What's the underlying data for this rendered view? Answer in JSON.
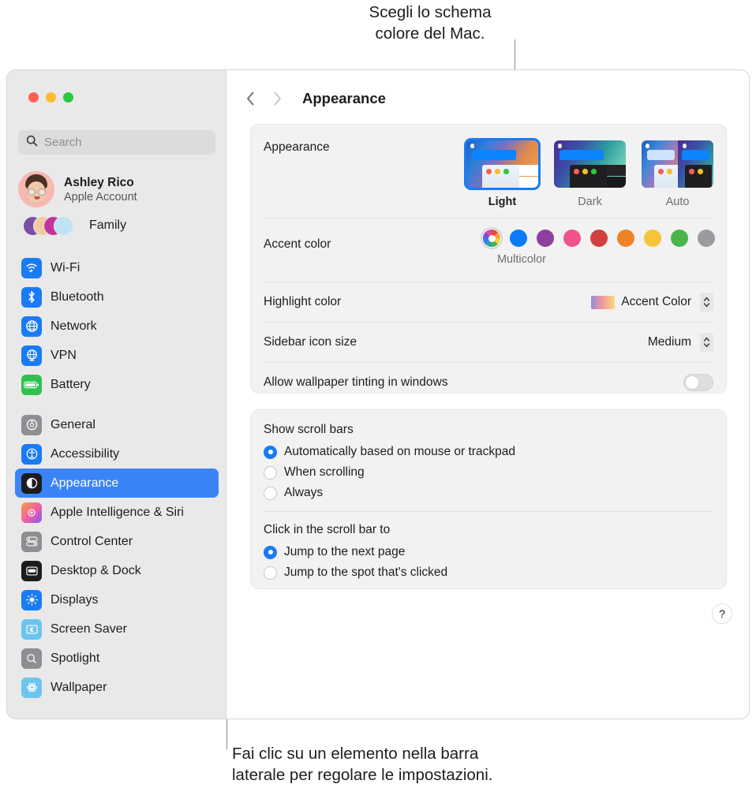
{
  "callouts": {
    "top": "Scegli lo schema\ncolore del Mac.",
    "bottom": "Fai clic su un elemento nella barra\nlaterale per regolare le impostazioni."
  },
  "window": {
    "traffic_lights": [
      {
        "name": "close",
        "color": "#FF5F57"
      },
      {
        "name": "minimize",
        "color": "#FEBC2E"
      },
      {
        "name": "zoom",
        "color": "#28C840"
      }
    ]
  },
  "sidebar": {
    "search": {
      "placeholder": "Search",
      "value": ""
    },
    "account": {
      "name": "Ashley Rico",
      "subtitle": "Apple Account"
    },
    "family": {
      "label": "Family"
    },
    "groups": [
      {
        "items": [
          {
            "label": "Wi-Fi",
            "icon": "wifi-icon",
            "color": "#1a7bf7",
            "selected": false
          },
          {
            "label": "Bluetooth",
            "icon": "bluetooth-icon",
            "color": "#1a7bf7",
            "selected": false
          },
          {
            "label": "Network",
            "icon": "globe-icon",
            "color": "#1a7bf7",
            "selected": false
          },
          {
            "label": "VPN",
            "icon": "vpn-globe-icon",
            "color": "#1a7bf7",
            "selected": false
          },
          {
            "label": "Battery",
            "icon": "battery-icon",
            "color": "#30c14e",
            "selected": false
          }
        ]
      },
      {
        "items": [
          {
            "label": "General",
            "icon": "gear-icon",
            "color": "#8e8e93",
            "selected": false
          },
          {
            "label": "Accessibility",
            "icon": "accessibility-icon",
            "color": "#1a7bf7",
            "selected": false
          },
          {
            "label": "Appearance",
            "icon": "appearance-icon",
            "color": "#1c1c1e",
            "selected": true
          },
          {
            "label": "Apple Intelligence & Siri",
            "icon": "siri-icon",
            "color": "#e05fa8",
            "selected": false
          },
          {
            "label": "Control Center",
            "icon": "control-center-icon",
            "color": "#8e8e93",
            "selected": false
          },
          {
            "label": "Desktop & Dock",
            "icon": "desktop-dock-icon",
            "color": "#1c1c1e",
            "selected": false
          },
          {
            "label": "Displays",
            "icon": "brightness-icon",
            "color": "#1a7bf7",
            "selected": false
          },
          {
            "label": "Screen Saver",
            "icon": "screen-saver-icon",
            "color": "#6cc5ef",
            "selected": false
          },
          {
            "label": "Spotlight",
            "icon": "search-icon",
            "color": "#8e8e93",
            "selected": false
          },
          {
            "label": "Wallpaper",
            "icon": "wallpaper-icon",
            "color": "#6cc5ef",
            "selected": false
          }
        ]
      }
    ]
  },
  "main": {
    "toolbar": {
      "back": "‹",
      "forward": "›",
      "title": "Appearance"
    },
    "appearance": {
      "label": "Appearance",
      "options": [
        {
          "name": "Light",
          "selected": true
        },
        {
          "name": "Dark",
          "selected": false
        },
        {
          "name": "Auto",
          "selected": false
        }
      ]
    },
    "accent": {
      "label": "Accent color",
      "selected_name": "Multicolor",
      "swatches": [
        {
          "name": "Multicolor",
          "color": "multicolor",
          "selected": true
        },
        {
          "name": "Blue",
          "color": "#0a7bf7",
          "selected": false
        },
        {
          "name": "Purple",
          "color": "#8f3f9e",
          "selected": false
        },
        {
          "name": "Pink",
          "color": "#f0528c",
          "selected": false
        },
        {
          "name": "Red",
          "color": "#d13f3f",
          "selected": false
        },
        {
          "name": "Orange",
          "color": "#ef8326",
          "selected": false
        },
        {
          "name": "Yellow",
          "color": "#f5c43a",
          "selected": false
        },
        {
          "name": "Green",
          "color": "#49b54b",
          "selected": false
        },
        {
          "name": "Graphite",
          "color": "#9a9a9f",
          "selected": false
        }
      ]
    },
    "highlight": {
      "label": "Highlight color",
      "value": "Accent Color"
    },
    "sidebar_icon_size": {
      "label": "Sidebar icon size",
      "value": "Medium"
    },
    "wallpaper_tinting": {
      "label": "Allow wallpaper tinting in windows",
      "on": false
    },
    "scroll_bars": {
      "title": "Show scroll bars",
      "options": [
        {
          "label": "Automatically based on mouse or trackpad",
          "selected": true
        },
        {
          "label": "When scrolling",
          "selected": false
        },
        {
          "label": "Always",
          "selected": false
        }
      ]
    },
    "scroll_click": {
      "title": "Click in the scroll bar to",
      "options": [
        {
          "label": "Jump to the next page",
          "selected": true
        },
        {
          "label": "Jump to the spot that's clicked",
          "selected": false
        }
      ]
    },
    "help": {
      "label": "?"
    }
  }
}
